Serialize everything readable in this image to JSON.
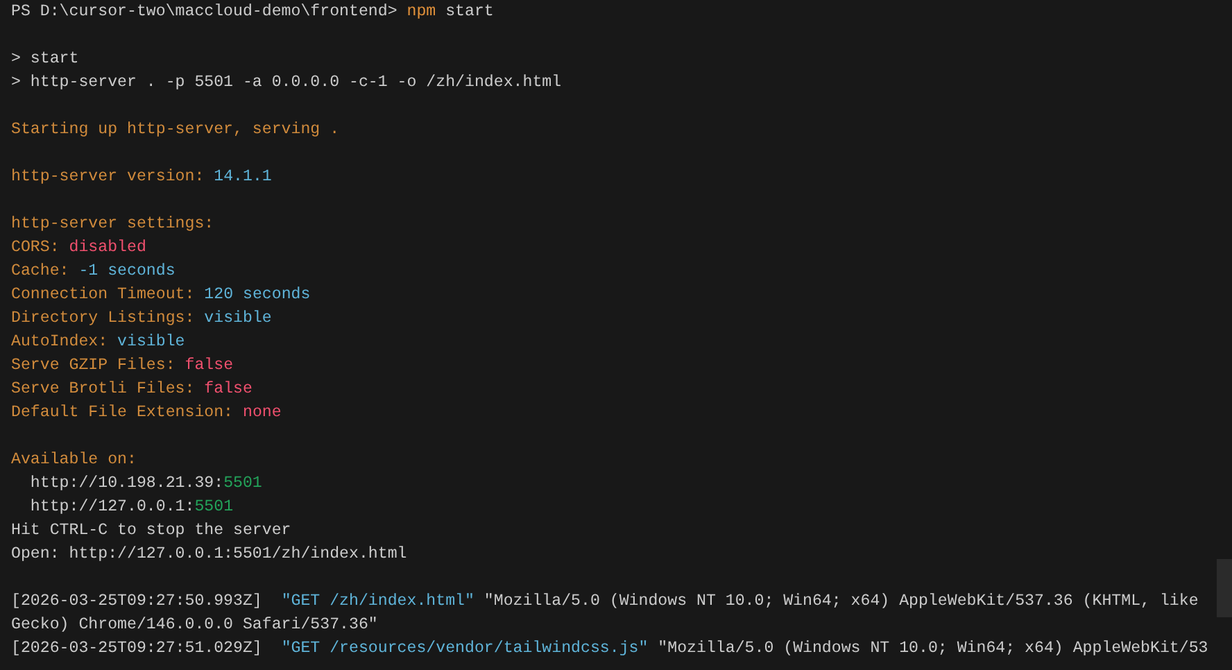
{
  "terminal": {
    "blocks": [
      {
        "lines": [
          {
            "segments": [
              {
                "text": "PS D:\\cursor-two\\maccloud-demo\\frontend> ",
                "color": "#cccccc"
              },
              {
                "text": "npm",
                "color": "#e0903a"
              },
              {
                "text": " start",
                "color": "#cccccc"
              }
            ]
          }
        ]
      },
      {
        "lines": [
          {
            "segments": [
              {
                "text": "> start",
                "color": "#cccccc"
              }
            ]
          },
          {
            "segments": [
              {
                "text": "> http-server . -p 5501 -a 0.0.0.0 -c-1 -o /zh/index.html",
                "color": "#cccccc"
              }
            ]
          }
        ]
      },
      {
        "lines": [
          {
            "segments": [
              {
                "text": "Starting up http-server, serving .",
                "color": "#d18b3c"
              }
            ]
          }
        ]
      },
      {
        "lines": [
          {
            "segments": [
              {
                "text": "http-server version: ",
                "color": "#d18b3c"
              },
              {
                "text": "14.1.1",
                "color": "#5fb4d9"
              }
            ]
          }
        ]
      },
      {
        "lines": [
          {
            "segments": [
              {
                "text": "http-server settings:",
                "color": "#d18b3c"
              }
            ]
          },
          {
            "segments": [
              {
                "text": "CORS: ",
                "color": "#d18b3c"
              },
              {
                "text": "disabled",
                "color": "#f0506e"
              }
            ]
          },
          {
            "segments": [
              {
                "text": "Cache: ",
                "color": "#d18b3c"
              },
              {
                "text": "-1 seconds",
                "color": "#5fb4d9"
              }
            ]
          },
          {
            "segments": [
              {
                "text": "Connection Timeout: ",
                "color": "#d18b3c"
              },
              {
                "text": "120 seconds",
                "color": "#5fb4d9"
              }
            ]
          },
          {
            "segments": [
              {
                "text": "Directory Listings: ",
                "color": "#d18b3c"
              },
              {
                "text": "visible",
                "color": "#5fb4d9"
              }
            ]
          },
          {
            "segments": [
              {
                "text": "AutoIndex: ",
                "color": "#d18b3c"
              },
              {
                "text": "visible",
                "color": "#5fb4d9"
              }
            ]
          },
          {
            "segments": [
              {
                "text": "Serve GZIP Files: ",
                "color": "#d18b3c"
              },
              {
                "text": "false",
                "color": "#f0506e"
              }
            ]
          },
          {
            "segments": [
              {
                "text": "Serve Brotli Files: ",
                "color": "#d18b3c"
              },
              {
                "text": "false",
                "color": "#f0506e"
              }
            ]
          },
          {
            "segments": [
              {
                "text": "Default File Extension: ",
                "color": "#d18b3c"
              },
              {
                "text": "none",
                "color": "#f0506e"
              }
            ]
          }
        ]
      },
      {
        "lines": [
          {
            "segments": [
              {
                "text": "Available on:",
                "color": "#d18b3c"
              }
            ]
          },
          {
            "segments": [
              {
                "text": "  http://10.198.21.39:",
                "color": "#cccccc"
              },
              {
                "text": "5501",
                "color": "#23a35a"
              }
            ]
          },
          {
            "segments": [
              {
                "text": "  http://127.0.0.1:",
                "color": "#cccccc"
              },
              {
                "text": "5501",
                "color": "#23a35a"
              }
            ]
          },
          {
            "segments": [
              {
                "text": "Hit CTRL-C to stop the server",
                "color": "#cccccc"
              }
            ]
          },
          {
            "segments": [
              {
                "text": "Open: http://127.0.0.1:5501/zh/index.html",
                "color": "#cccccc"
              }
            ]
          }
        ]
      },
      {
        "lines": [
          {
            "segments": [
              {
                "text": "[2026-03-25T09:27:50.993Z]  ",
                "color": "#cccccc"
              },
              {
                "text": "\"GET /zh/index.html\"",
                "color": "#5fb4d9"
              },
              {
                "text": " \"Mozilla/5.0 (Windows NT 10.0; Win64; x64) AppleWebKit/537.36 (KHTML, like",
                "color": "#cccccc"
              }
            ]
          },
          {
            "segments": [
              {
                "text": "Gecko) Chrome/146.0.0.0 Safari/537.36\"",
                "color": "#cccccc"
              }
            ]
          },
          {
            "segments": [
              {
                "text": "[2026-03-25T09:27:51.029Z]  ",
                "color": "#cccccc"
              },
              {
                "text": "\"GET /resources/vendor/tailwindcss.js\"",
                "color": "#5fb4d9"
              },
              {
                "text": " \"Mozilla/5.0 (Windows NT 10.0; Win64; x64) AppleWebKit/53",
                "color": "#cccccc"
              }
            ]
          }
        ]
      }
    ]
  }
}
